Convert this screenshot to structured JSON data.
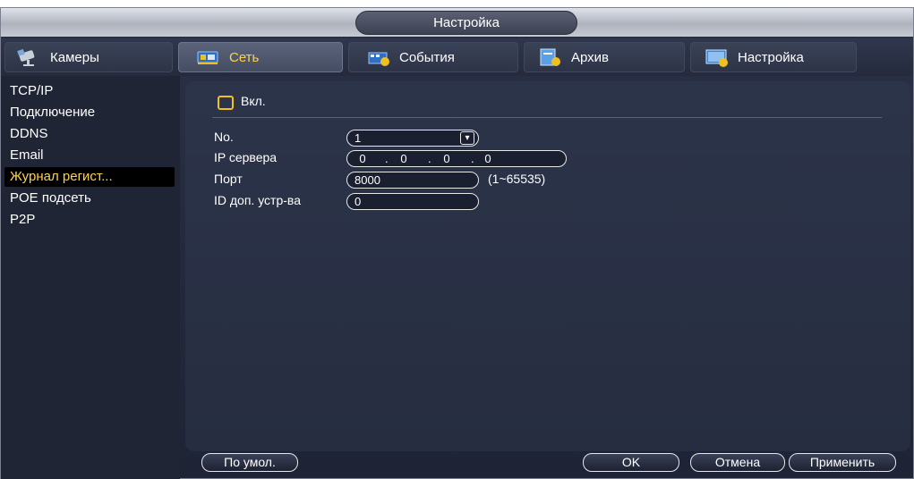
{
  "window": {
    "title": "Настройка"
  },
  "tabs": [
    {
      "label": "Камеры",
      "icon": "camera-icon"
    },
    {
      "label": "Сеть",
      "icon": "network-icon"
    },
    {
      "label": "События",
      "icon": "events-icon"
    },
    {
      "label": "Архив",
      "icon": "archive-icon"
    },
    {
      "label": "Настройка",
      "icon": "settings-icon"
    }
  ],
  "sidebar": {
    "items": [
      {
        "label": "TCP/IP"
      },
      {
        "label": "Подключение"
      },
      {
        "label": "DDNS"
      },
      {
        "label": "Email"
      },
      {
        "label": "Журнал регист..."
      },
      {
        "label": "POE подсеть"
      },
      {
        "label": "P2P"
      }
    ],
    "active_index": 4
  },
  "form": {
    "enable_label": "Вкл.",
    "no_label": "No.",
    "no_value": "1",
    "server_ip_label": "IP сервера",
    "server_ip": [
      "0",
      "0",
      "0",
      "0"
    ],
    "port_label": "Порт",
    "port_value": "8000",
    "port_range": "(1~65535)",
    "device_id_label": "ID доп. устр-ва",
    "device_id_value": "0"
  },
  "buttons": {
    "default": "По умол.",
    "ok": "OK",
    "cancel": "Отмена",
    "apply": "Применить"
  },
  "colors": {
    "accent": "#ffd24a",
    "panel": "#2a3146",
    "checkbox": "#f0c020"
  }
}
